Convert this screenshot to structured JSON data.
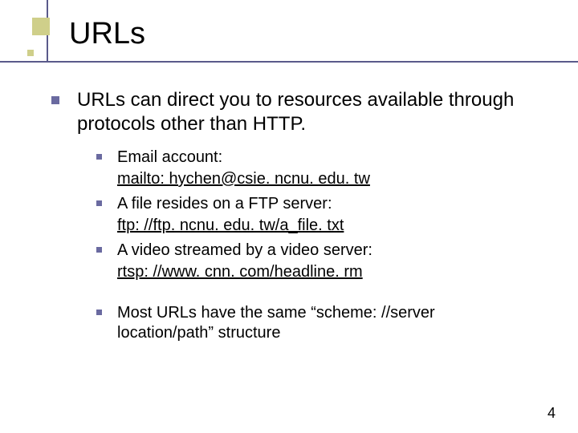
{
  "title": "URLs",
  "intro": "URLs can direct you to resources available through protocols other than HTTP.",
  "items": [
    {
      "label": "Email account:",
      "link": "mailto: hychen@csie. ncnu. edu. tw"
    },
    {
      "label": "A file resides on a FTP server:",
      "link": "ftp: //ftp. ncnu. edu. tw/a_file. txt"
    },
    {
      "label": "A video streamed by a video server:",
      "link": "rtsp: //www. cnn. com/headline. rm"
    }
  ],
  "note": "Most URLs have the same “scheme: //server location/path” structure",
  "slide_number": "4"
}
